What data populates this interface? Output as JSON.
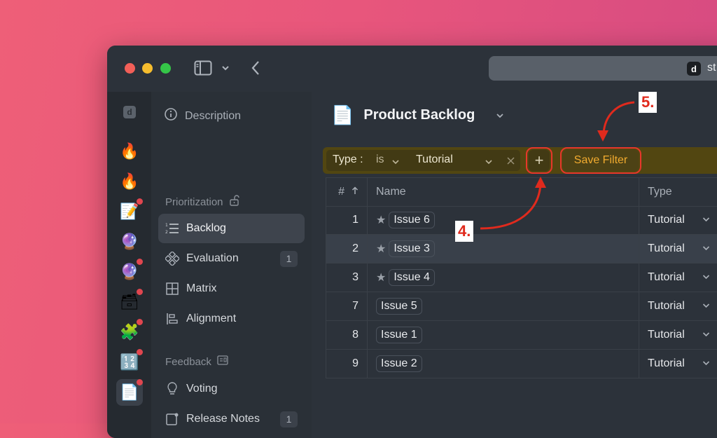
{
  "window": {
    "url_text": "st",
    "url_logo": "d"
  },
  "rail": {
    "logo": "d",
    "items": [
      {
        "icon": "🔥",
        "badge": false
      },
      {
        "icon": "🔥",
        "badge": false
      },
      {
        "icon": "📝",
        "badge": true
      },
      {
        "icon": "🔮",
        "badge": false
      },
      {
        "icon": "🔮",
        "badge": true
      },
      {
        "icon": "🗃",
        "badge": true
      },
      {
        "icon": "🧩",
        "badge": true
      },
      {
        "icon": "🔢",
        "badge": true
      },
      {
        "icon": "📄",
        "badge": true
      }
    ]
  },
  "sidebar": {
    "description": "Description",
    "prioritization_label": "Prioritization",
    "feedback_label": "Feedback",
    "items": [
      {
        "label": "Backlog",
        "count": ""
      },
      {
        "label": "Evaluation",
        "count": "1"
      },
      {
        "label": "Matrix",
        "count": ""
      },
      {
        "label": "Alignment",
        "count": ""
      }
    ],
    "feedback_items": [
      {
        "label": "Voting",
        "count": ""
      },
      {
        "label": "Release Notes",
        "count": "1"
      }
    ]
  },
  "main": {
    "title": "Product Backlog",
    "filter": {
      "field": "Type :",
      "operator": "is",
      "value": "Tutorial",
      "add_label": "+",
      "save_label": "Save Filter"
    },
    "table": {
      "headers": {
        "num": "#",
        "name": "Name",
        "type": "Type"
      },
      "rows": [
        {
          "num": "1",
          "name": "Issue 6",
          "type": "Tutorial",
          "starred": true
        },
        {
          "num": "2",
          "name": "Issue 3",
          "type": "Tutorial",
          "starred": true
        },
        {
          "num": "3",
          "name": "Issue 4",
          "type": "Tutorial",
          "starred": true
        },
        {
          "num": "7",
          "name": "Issue 5",
          "type": "Tutorial",
          "starred": false
        },
        {
          "num": "8",
          "name": "Issue 1",
          "type": "Tutorial",
          "starred": false
        },
        {
          "num": "9",
          "name": "Issue 2",
          "type": "Tutorial",
          "starred": false
        }
      ]
    }
  },
  "annotations": {
    "step4": "4.",
    "step5": "5."
  },
  "colors": {
    "accent": "#f2ab2f",
    "highlight": "#e8372a",
    "filter_bg": "#524611"
  }
}
